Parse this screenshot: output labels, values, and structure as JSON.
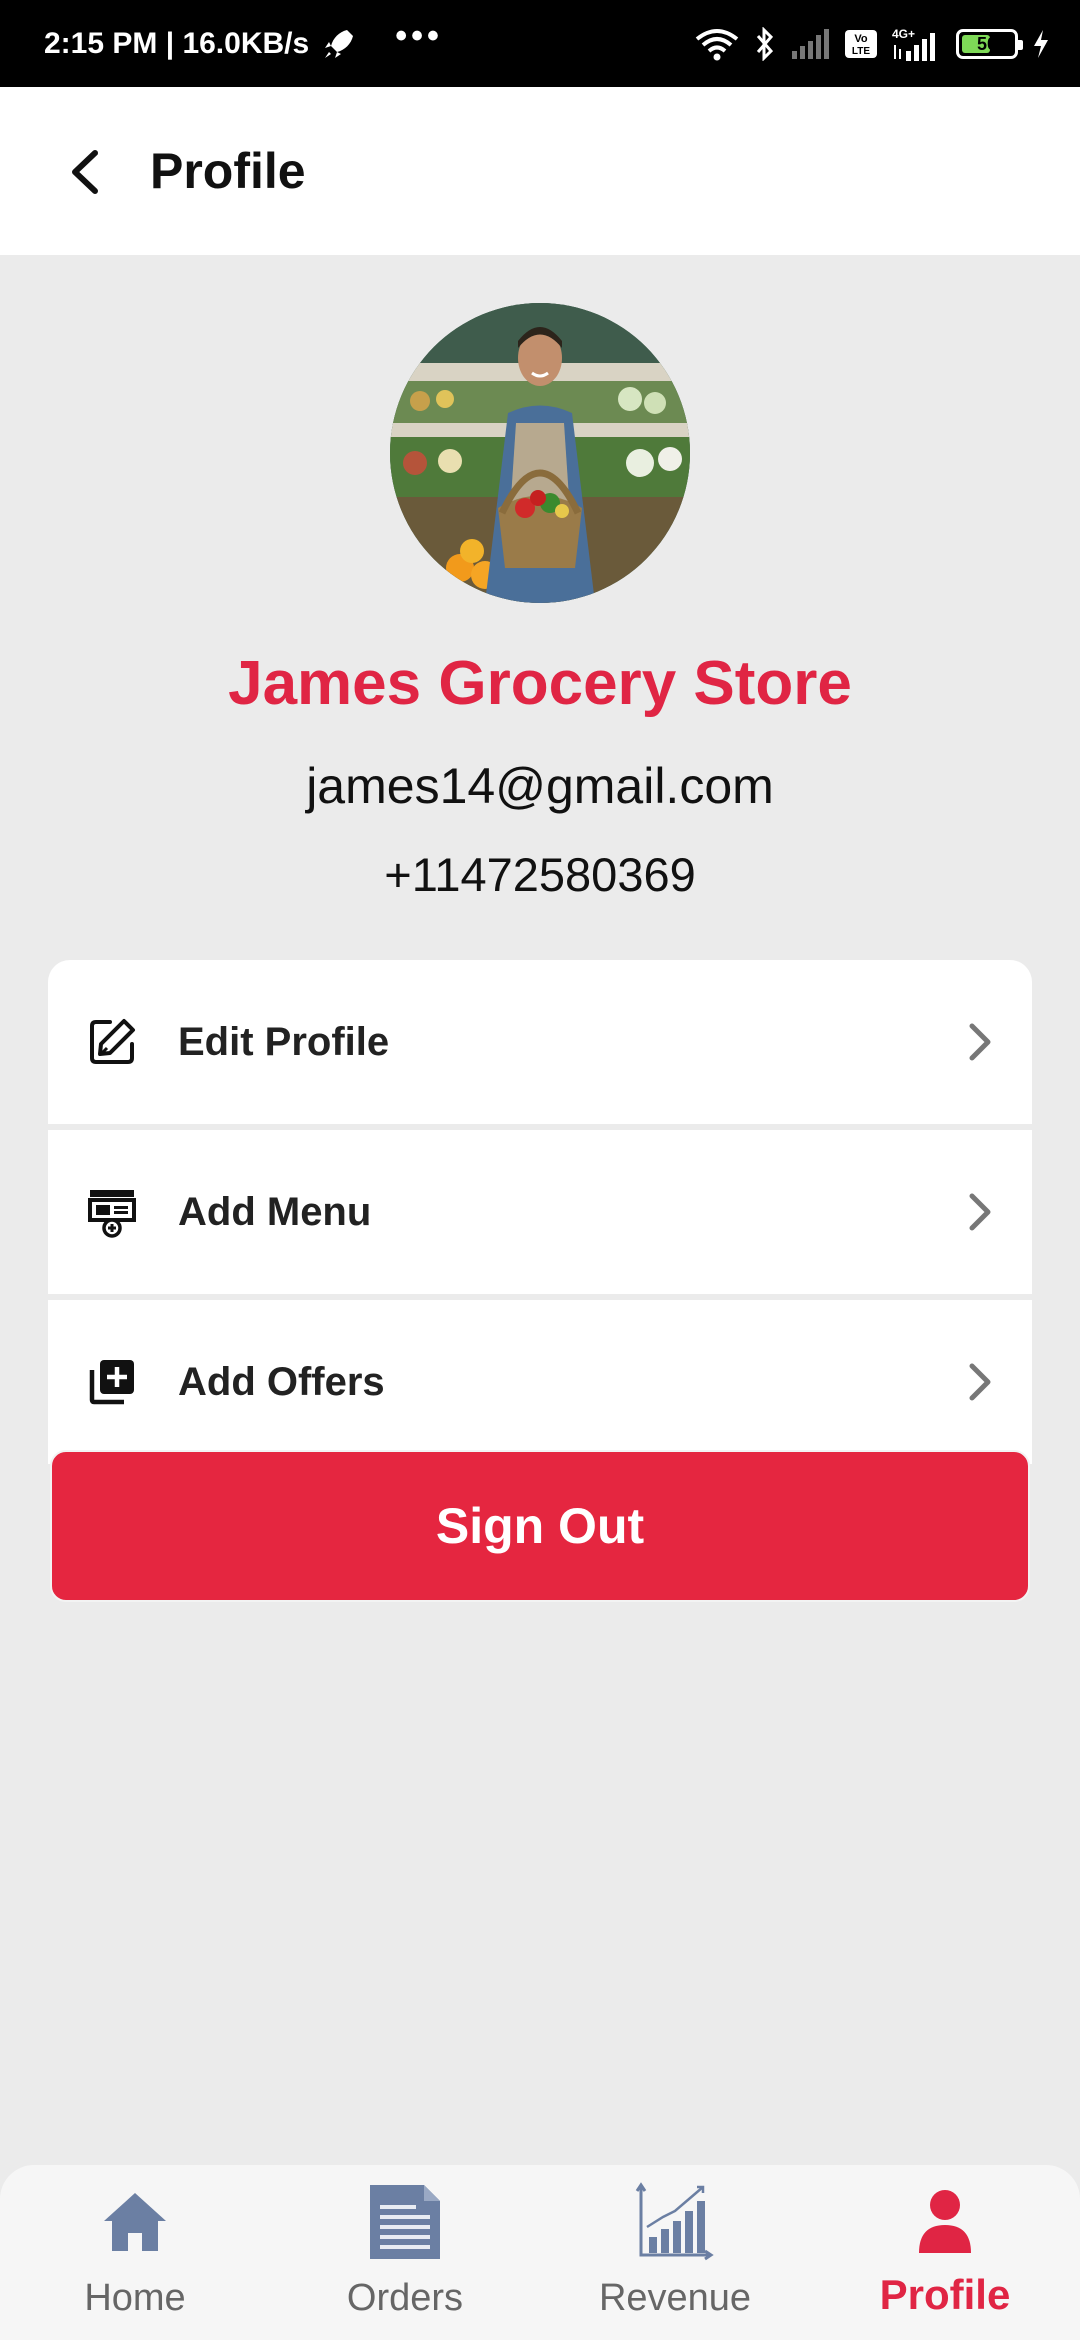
{
  "status_bar": {
    "time_speed": "2:15 PM | 16.0KB/s",
    "battery": "50",
    "network": "4G+"
  },
  "app_bar": {
    "title": "Profile"
  },
  "profile": {
    "store_name": "James Grocery Store",
    "email": "james14@gmail.com",
    "phone": "+11472580369"
  },
  "menu": {
    "items": [
      {
        "label": "Edit Profile",
        "icon": "edit-icon"
      },
      {
        "label": "Add Menu",
        "icon": "add-menu-icon"
      },
      {
        "label": "Add Offers",
        "icon": "add-offers-icon"
      }
    ]
  },
  "signout": {
    "label": "Sign Out"
  },
  "bottom_nav": {
    "items": [
      {
        "label": "Home",
        "icon": "home-icon"
      },
      {
        "label": "Orders",
        "icon": "orders-icon"
      },
      {
        "label": "Revenue",
        "icon": "revenue-icon"
      },
      {
        "label": "Profile",
        "icon": "profile-icon",
        "active": true
      }
    ]
  },
  "colors": {
    "accent": "#e52640",
    "nav_inactive": "#6b7fa3",
    "background": "#ebebeb"
  }
}
